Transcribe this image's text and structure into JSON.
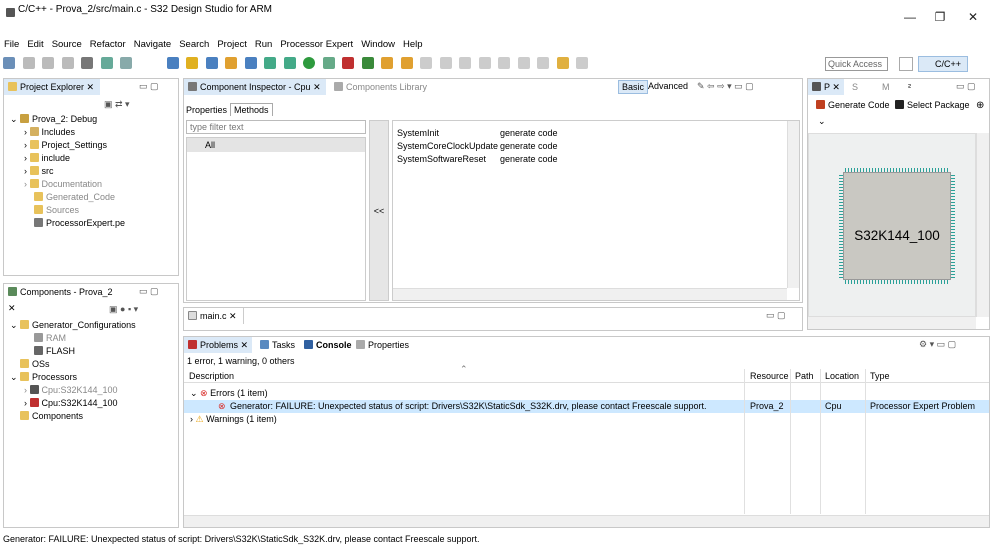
{
  "window": {
    "title": "C/C++ - Prova_2/src/main.c - S32 Design Studio for ARM",
    "minimize": "—",
    "restore": "❐",
    "close": "✕"
  },
  "menu": [
    "File",
    "Edit",
    "Source",
    "Refactor",
    "Navigate",
    "Search",
    "Project",
    "Run",
    "Processor Expert",
    "Window",
    "Help"
  ],
  "toolbar": {
    "quick_access_placeholder": "Quick Access",
    "perspective_label": "C/C++"
  },
  "project_explorer": {
    "tab": "Project Explorer",
    "root": "Prova_2: Debug",
    "items": [
      "Includes",
      "Project_Settings",
      "include",
      "src",
      "Documentation",
      "Generated_Code",
      "Sources",
      "ProcessorExpert.pe"
    ]
  },
  "components": {
    "tab": "Components - Prova_2",
    "items": {
      "gen": "Generator_Configurations",
      "ram": "RAM",
      "flash": "FLASH",
      "oss": "OSs",
      "processors": "Processors",
      "cpu1": "Cpu:S32K144_100",
      "cpu2": "Cpu:S32K144_100",
      "components": "Components"
    }
  },
  "inspector": {
    "tab": "Component Inspector - Cpu",
    "tab2": "Components Library",
    "basic": "Basic",
    "advanced": "Advanced",
    "tab_properties": "Properties",
    "tab_methods": "Methods",
    "filter_placeholder": "type filter text",
    "list_all": "All",
    "arrow": "<<",
    "methods": [
      {
        "name": "SystemInit",
        "value": "generate code"
      },
      {
        "name": "SystemCoreClockUpdate",
        "value": "generate code"
      },
      {
        "name": "SystemSoftwareReset",
        "value": "generate code"
      }
    ]
  },
  "package_panel": {
    "tab_p": "P",
    "tab_s": "S",
    "tab_m": "M",
    "tab_2": "²",
    "generate_code": "Generate Code",
    "select_package": "Select Package",
    "chip_label": "S32K144_100"
  },
  "editor": {
    "tab": "main.c"
  },
  "problems": {
    "tab_problems": "Problems",
    "tab_tasks": "Tasks",
    "tab_console": "Console",
    "tab_properties": "Properties",
    "summary": "1 error, 1 warning, 0 others",
    "columns": [
      "Description",
      "Resource",
      "Path",
      "Location",
      "Type"
    ],
    "errors_group": "Errors (1 item)",
    "error_row": {
      "description": "Generator: FAILURE: Unexpected status of script: Drivers\\S32K\\StaticSdk_S32K.drv, please contact Freescale support.",
      "resource": "Prova_2",
      "path": "",
      "location": "Cpu",
      "type": "Processor Expert Problem"
    },
    "warnings_group": "Warnings (1 item)"
  },
  "statusbar": {
    "text": "Generator: FAILURE: Unexpected status of script: Drivers\\S32K\\StaticSdk_S32K.drv, please contact Freescale support."
  },
  "colors": {
    "selection": "#cde8ff",
    "error": "#d9302c",
    "warning": "#e8a20c",
    "folder": "#e8c25b"
  }
}
